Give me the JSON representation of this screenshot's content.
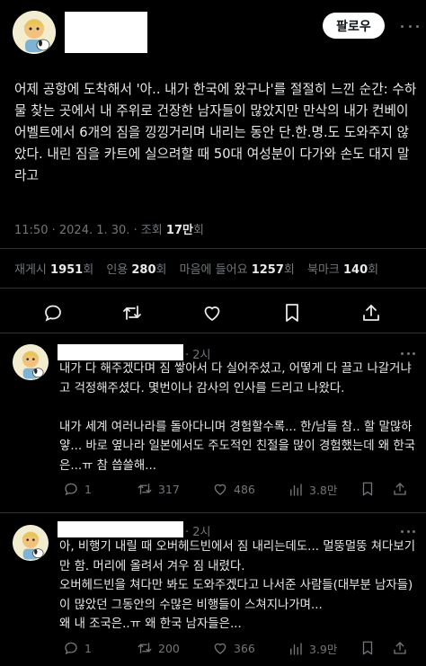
{
  "header": {
    "follow_label": "팔로우"
  },
  "post": {
    "text": "어제 공항에 도착해서 '아.. 내가 한국에 왔구나'를 절절히 느낀 순간: 수하물 찾는 곳에서 내 주위로 건장한 남자들이 많았지만 만삭의 내가 컨베이어벨트에서 6개의 짐을 낑낑거리며 내리는 동안 단.한.명.도 도와주지 않았다. 내린 짐을 카트에 실으려할 때 50대 여성분이 다가와 손도 대지 말라고",
    "time": "11:50",
    "date": "2024. 1. 30.",
    "views_label": "조회",
    "views_value": "17만",
    "views_suffix": "회"
  },
  "stats": {
    "reposts_label": "재게시",
    "reposts_value": "1951",
    "reposts_suffix": "회",
    "quotes_label": "인용",
    "quotes_value": "280",
    "quotes_suffix": "회",
    "likes_label": "마음에 들어요",
    "likes_value": "1257",
    "likes_suffix": "회",
    "bookmarks_label": "북마크",
    "bookmarks_value": "140",
    "bookmarks_suffix": "회"
  },
  "actions": [
    "reply-icon",
    "repost-icon",
    "like-icon",
    "bookmark-icon",
    "share-icon"
  ],
  "replies": [
    {
      "time": "· 2시",
      "text": "내가 다 해주겠다며 짐 쌓아서 다 실어주셨고, 어떻게 다 끌고 나갈거냐고 걱정해주셨다. 몇번이나 감사의 인사를 드리고 나왔다.\n\n내가 세계 여러나라를 돌아다니며 경험할수록... 한/남들 참.. 할 말많하얗... 바로 옆나라 일본에서도 주도적인 친절을 많이 경험했는데 왜 한국은...ㅠ 참 씁쓸해...",
      "replies": "1",
      "reposts": "317",
      "likes": "486",
      "views": "3.8만"
    },
    {
      "time": "· 2시",
      "text": "아, 비행기 내릴 때 오버헤드빈에서 짐 내리는데도... 멀뚱멀뚱 쳐다보기만 함. 머리에 올려서 겨우 짐 내렸다.\n오버헤드빈을 쳐다만 봐도 도와주겠다고 나서준 사람들(대부분 남자들)이 많았던 그동안의 수많은 비행들이 스쳐지나가며...\n왜 내 조국은..ㅠ 왜 한국 남자들은...",
      "replies": "1",
      "reposts": "200",
      "likes": "366",
      "views": "3.9만"
    }
  ]
}
